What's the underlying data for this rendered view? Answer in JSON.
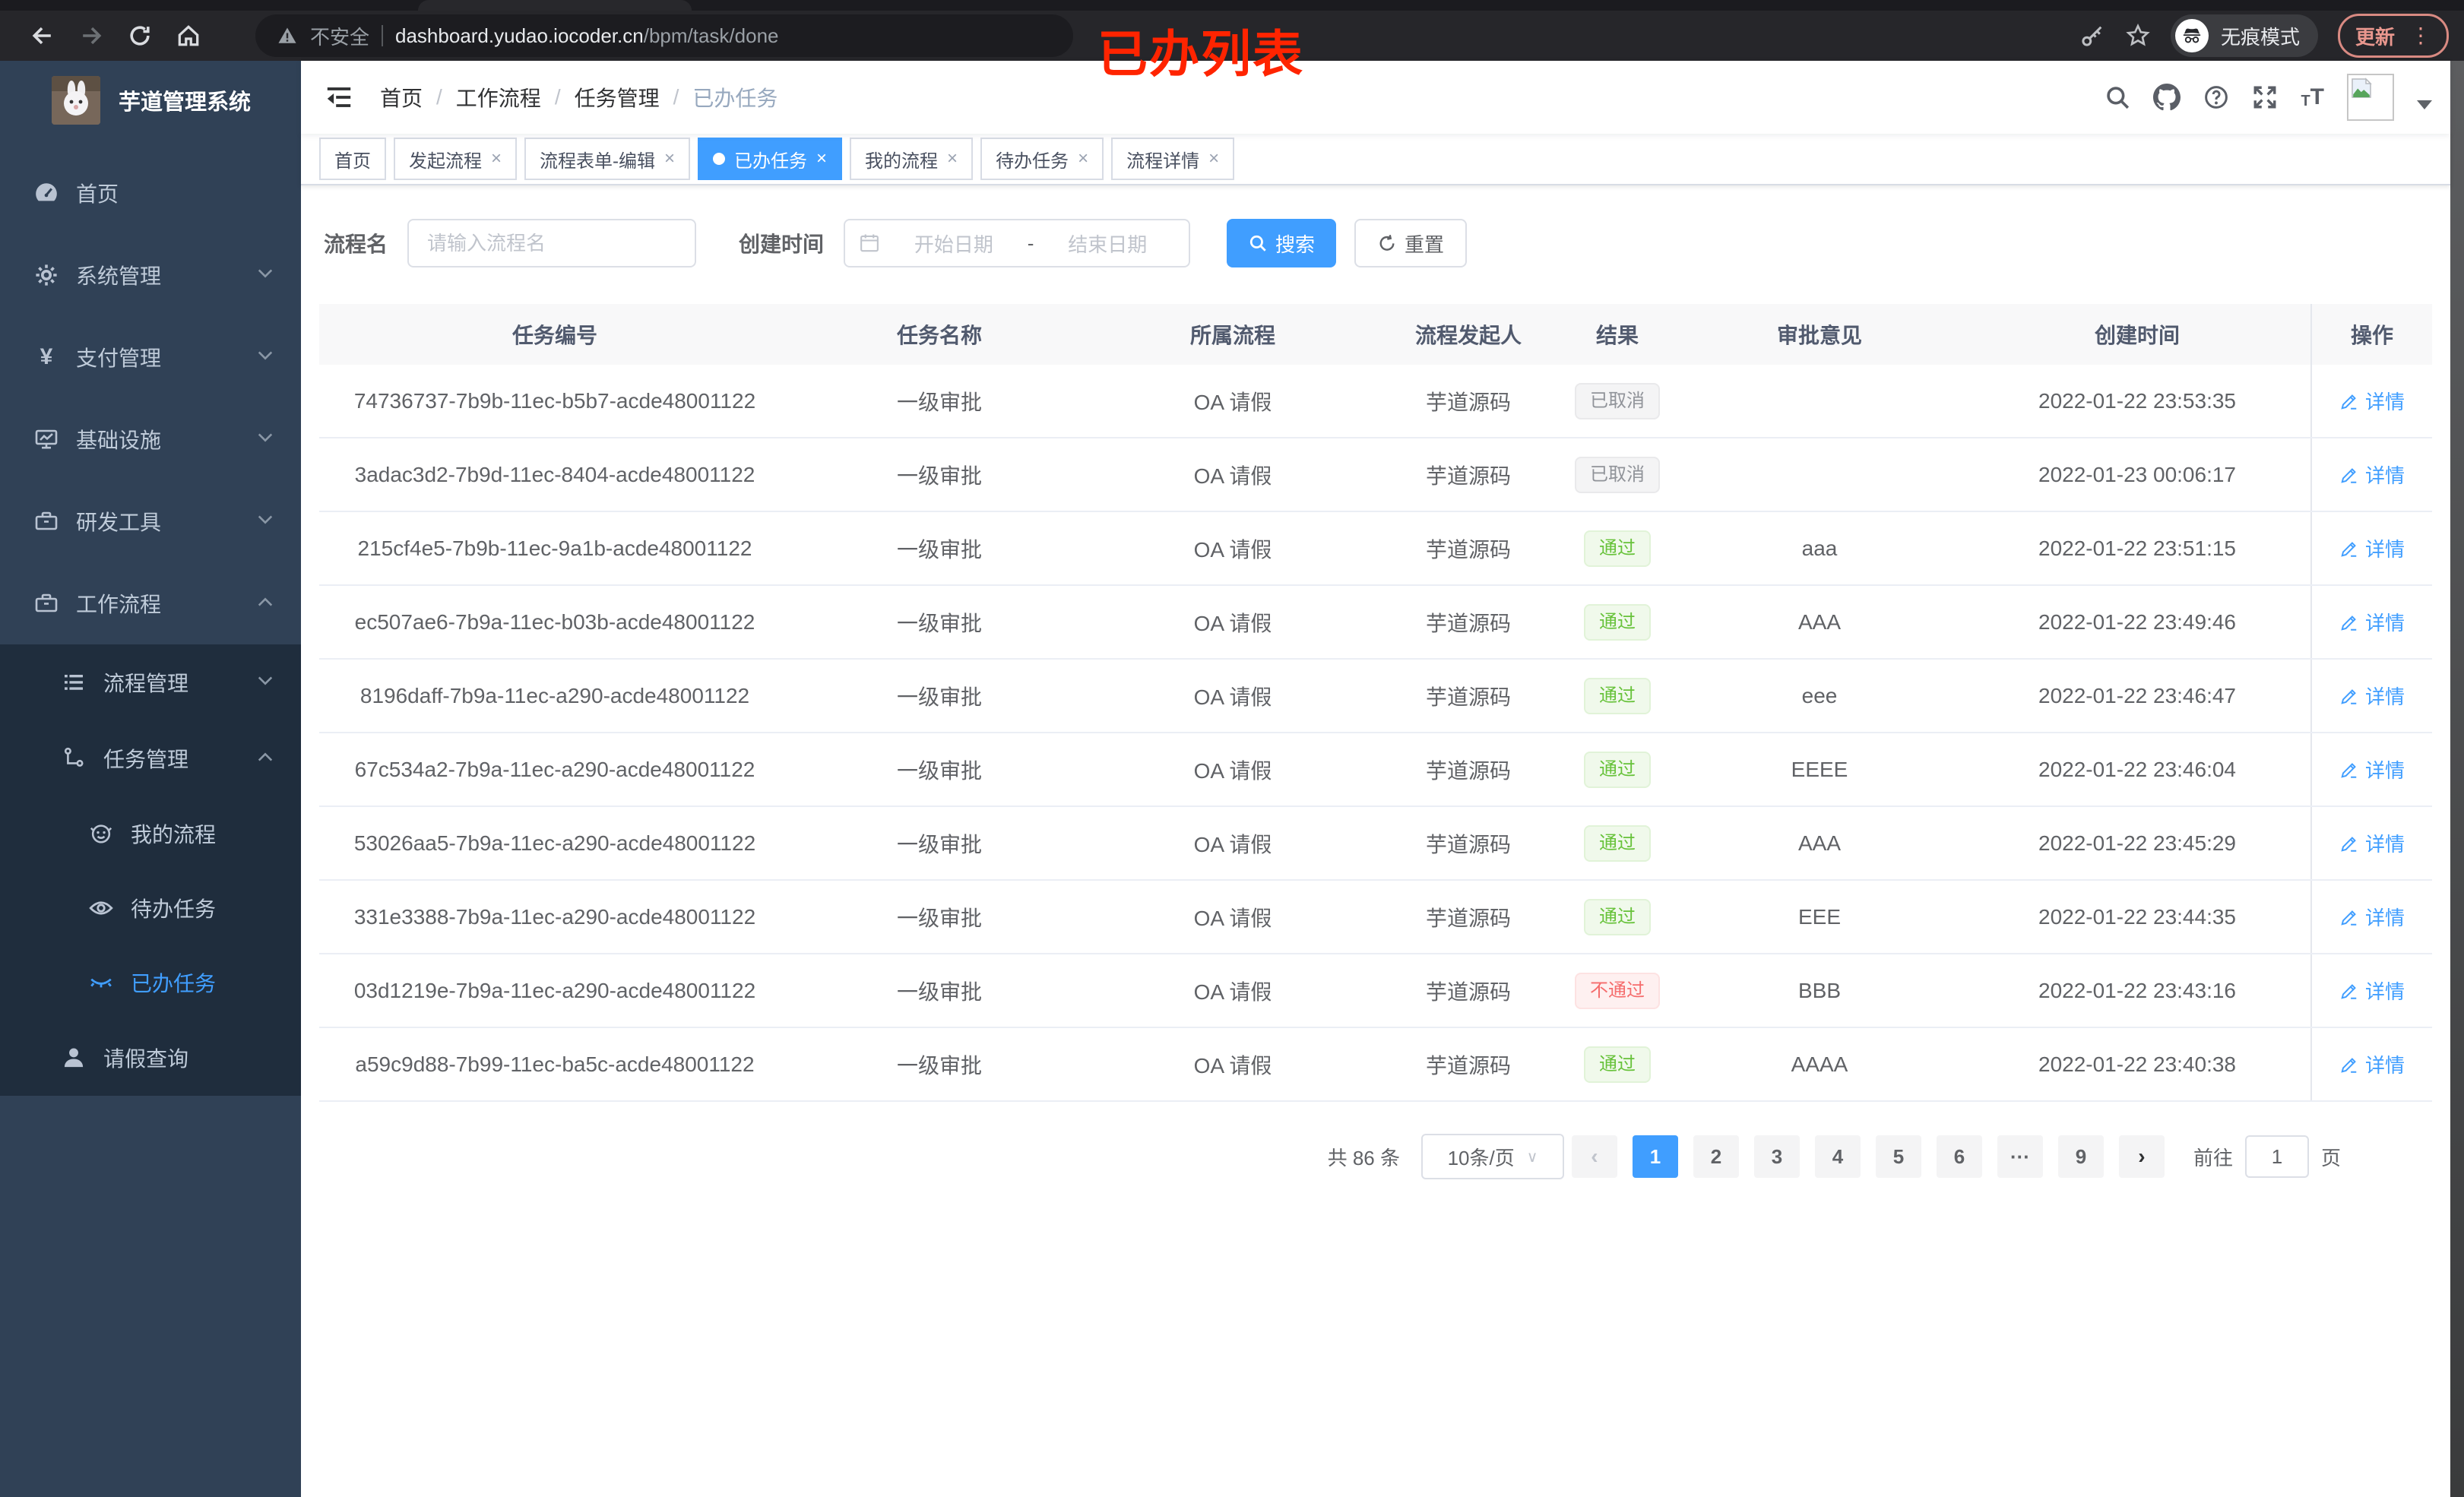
{
  "browser": {
    "security_warning": "不安全",
    "url_host": "dashboard.yudao.iocoder.cn",
    "url_path": "/bpm/task/done",
    "incognito_label": "无痕模式",
    "update_label": "更新",
    "menu_dots": "⋮",
    "nav_icons": [
      "back-icon",
      "forward-icon",
      "reload-icon",
      "home-icon",
      "key-icon",
      "star-icon",
      "incognito-icon"
    ]
  },
  "annotation": {
    "text": "已办列表",
    "color": "#ff2400"
  },
  "colors": {
    "accent": "#409eff",
    "sidebar_bg": "#304156",
    "submenu_bg": "#1f2d3d",
    "success_text": "#67c23a",
    "success_bg": "#f0f9eb",
    "danger_text": "#f56c6c",
    "danger_bg": "#fef0f0",
    "info_text": "#909399",
    "info_bg": "#f4f4f5",
    "annotation_red": "#ff2400",
    "update_button": "#e9978e"
  },
  "sidebar": {
    "title": "芋道管理系统",
    "items": [
      {
        "key": "home",
        "label": "首页",
        "icon": "dashboard",
        "level": 1,
        "chevron": null,
        "active": false
      },
      {
        "key": "system",
        "label": "系统管理",
        "icon": "gear",
        "level": 1,
        "chevron": "down",
        "active": false
      },
      {
        "key": "payment",
        "label": "支付管理",
        "icon": "yen",
        "level": 1,
        "chevron": "down",
        "active": false
      },
      {
        "key": "infra",
        "label": "基础设施",
        "icon": "monitor",
        "level": 1,
        "chevron": "down",
        "active": false
      },
      {
        "key": "dev-tools",
        "label": "研发工具",
        "icon": "toolbox",
        "level": 1,
        "chevron": "down",
        "active": false
      },
      {
        "key": "workflow",
        "label": "工作流程",
        "icon": "toolbox",
        "level": 1,
        "chevron": "up",
        "active": false
      },
      {
        "key": "process-mgmt",
        "label": "流程管理",
        "icon": "list",
        "level": 2,
        "chevron": "down",
        "active": false
      },
      {
        "key": "task-mgmt",
        "label": "任务管理",
        "icon": "tree",
        "level": 2,
        "chevron": "up",
        "active": false
      },
      {
        "key": "my-process",
        "label": "我的流程",
        "icon": "robot",
        "level": 3,
        "chevron": null,
        "active": false
      },
      {
        "key": "todo-task",
        "label": "待办任务",
        "icon": "eye",
        "level": 3,
        "chevron": null,
        "active": false
      },
      {
        "key": "done-task",
        "label": "已办任务",
        "icon": "eye-closed",
        "level": 3,
        "chevron": null,
        "active": true
      },
      {
        "key": "leave-query",
        "label": "请假查询",
        "icon": "user",
        "level": 2,
        "chevron": null,
        "active": false
      }
    ]
  },
  "breadcrumb": {
    "items": [
      "首页",
      "工作流程",
      "任务管理",
      "已办任务"
    ],
    "separator": "/"
  },
  "navbar_icons": [
    "hamburger-icon",
    "search-icon",
    "github-icon",
    "question-icon",
    "fullscreen-icon",
    "font-size-icon",
    "avatar",
    "dropdown-caret"
  ],
  "tabs": [
    {
      "key": "home",
      "label": "首页",
      "closable": false,
      "active": false
    },
    {
      "key": "start-proc",
      "label": "发起流程",
      "closable": true,
      "active": false
    },
    {
      "key": "form-edit",
      "label": "流程表单-编辑",
      "closable": true,
      "active": false
    },
    {
      "key": "done-task",
      "label": "已办任务",
      "closable": true,
      "active": true
    },
    {
      "key": "my-process",
      "label": "我的流程",
      "closable": true,
      "active": false
    },
    {
      "key": "todo-task",
      "label": "待办任务",
      "closable": true,
      "active": false
    },
    {
      "key": "proc-detail",
      "label": "流程详情",
      "closable": true,
      "active": false
    }
  ],
  "filters": {
    "name_label": "流程名",
    "name_placeholder": "请输入流程名",
    "date_label": "创建时间",
    "date_start_placeholder": "开始日期",
    "date_separator": "-",
    "date_end_placeholder": "结束日期",
    "search_label": "搜索",
    "reset_label": "重置"
  },
  "table": {
    "columns": [
      "任务编号",
      "任务名称",
      "所属流程",
      "流程发起人",
      "结果",
      "审批意见",
      "创建时间",
      "操作"
    ],
    "action_label": "详情",
    "rows": [
      {
        "id": "74736737-7b9b-11ec-b5b7-acde48001122",
        "name": "一级审批",
        "process": "OA 请假",
        "starter": "芋道源码",
        "result": "已取消",
        "result_type": "info",
        "opinion": "",
        "created": "2022-01-22 23:53:35"
      },
      {
        "id": "3adac3d2-7b9d-11ec-8404-acde48001122",
        "name": "一级审批",
        "process": "OA 请假",
        "starter": "芋道源码",
        "result": "已取消",
        "result_type": "info",
        "opinion": "",
        "created": "2022-01-23 00:06:17"
      },
      {
        "id": "215cf4e5-7b9b-11ec-9a1b-acde48001122",
        "name": "一级审批",
        "process": "OA 请假",
        "starter": "芋道源码",
        "result": "通过",
        "result_type": "success",
        "opinion": "aaa",
        "created": "2022-01-22 23:51:15"
      },
      {
        "id": "ec507ae6-7b9a-11ec-b03b-acde48001122",
        "name": "一级审批",
        "process": "OA 请假",
        "starter": "芋道源码",
        "result": "通过",
        "result_type": "success",
        "opinion": "AAA",
        "created": "2022-01-22 23:49:46"
      },
      {
        "id": "8196daff-7b9a-11ec-a290-acde48001122",
        "name": "一级审批",
        "process": "OA 请假",
        "starter": "芋道源码",
        "result": "通过",
        "result_type": "success",
        "opinion": "eee",
        "created": "2022-01-22 23:46:47"
      },
      {
        "id": "67c534a2-7b9a-11ec-a290-acde48001122",
        "name": "一级审批",
        "process": "OA 请假",
        "starter": "芋道源码",
        "result": "通过",
        "result_type": "success",
        "opinion": "EEEE",
        "created": "2022-01-22 23:46:04"
      },
      {
        "id": "53026aa5-7b9a-11ec-a290-acde48001122",
        "name": "一级审批",
        "process": "OA 请假",
        "starter": "芋道源码",
        "result": "通过",
        "result_type": "success",
        "opinion": "AAA",
        "created": "2022-01-22 23:45:29"
      },
      {
        "id": "331e3388-7b9a-11ec-a290-acde48001122",
        "name": "一级审批",
        "process": "OA 请假",
        "starter": "芋道源码",
        "result": "通过",
        "result_type": "success",
        "opinion": "EEE",
        "created": "2022-01-22 23:44:35"
      },
      {
        "id": "03d1219e-7b9a-11ec-a290-acde48001122",
        "name": "一级审批",
        "process": "OA 请假",
        "starter": "芋道源码",
        "result": "不通过",
        "result_type": "danger",
        "opinion": "BBB",
        "created": "2022-01-22 23:43:16"
      },
      {
        "id": "a59c9d88-7b99-11ec-ba5c-acde48001122",
        "name": "一级审批",
        "process": "OA 请假",
        "starter": "芋道源码",
        "result": "通过",
        "result_type": "success",
        "opinion": "AAAA",
        "created": "2022-01-22 23:40:38"
      }
    ]
  },
  "pagination": {
    "total": "共 86 条",
    "page_size": "10条/页",
    "prev": "‹",
    "next": "›",
    "pages": [
      "1",
      "2",
      "3",
      "4",
      "5",
      "6",
      "···",
      "9"
    ],
    "active_page": "1",
    "goto_label": "前往",
    "goto_value": "1",
    "goto_unit": "页"
  }
}
